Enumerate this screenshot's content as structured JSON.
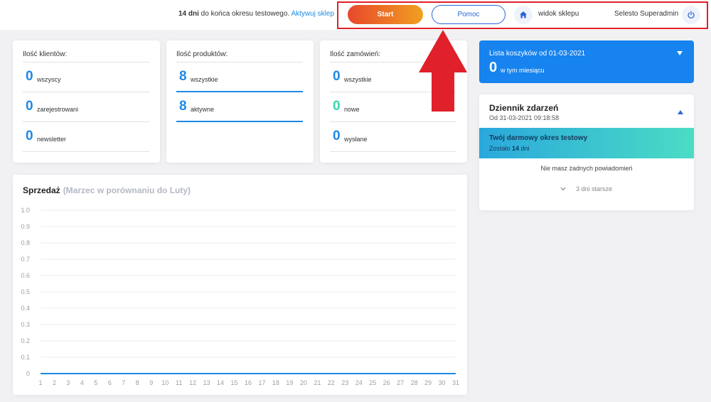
{
  "topbar": {
    "trial_days": "14 dni",
    "trial_text": " do końca okresu testowego. ",
    "activate_link": "Aktywuj sklep",
    "start_button": "Start",
    "help_button": "Pomoc",
    "shop_view_link": "widok sklepu",
    "user_name": "Selesto Superadmin",
    "home_icon": "home-icon",
    "power_icon": "power-icon"
  },
  "annotation": {
    "color": "#e0202a"
  },
  "stats": {
    "clients": {
      "title": "Ilość klientów:",
      "rows": [
        {
          "value": "0",
          "label": "wszyscy"
        },
        {
          "value": "0",
          "label": "zarejestrowani"
        },
        {
          "value": "0",
          "label": "newsletter"
        }
      ]
    },
    "products": {
      "title": "Ilość produktów:",
      "rows": [
        {
          "value": "8",
          "label": "wszystkie"
        },
        {
          "value": "8",
          "label": "aktywne"
        }
      ]
    },
    "orders": {
      "title": "Ilość zamówień:",
      "rows": [
        {
          "value": "0",
          "label": "wszystkie"
        },
        {
          "value": "0",
          "label": "nowe"
        },
        {
          "value": "0",
          "label": "wysłane"
        }
      ]
    }
  },
  "sales": {
    "title": "Sprzedaż",
    "subtitle": "(Marzec w porównaniu do Luty)"
  },
  "chart_data": {
    "type": "line",
    "title": "Sprzedaż",
    "subtitle": "(Marzec w porównaniu do Luty)",
    "x": [
      1,
      2,
      3,
      4,
      5,
      6,
      7,
      8,
      9,
      10,
      11,
      12,
      13,
      14,
      15,
      16,
      17,
      18,
      19,
      20,
      21,
      22,
      23,
      24,
      25,
      26,
      27,
      28,
      29,
      30,
      31
    ],
    "y_ticks": [
      "0",
      "0.1",
      "0.2",
      "0.3",
      "0.4",
      "0.5",
      "0.6",
      "0.7",
      "0.8",
      "0.9",
      "1.0"
    ],
    "ylim": [
      0,
      1
    ],
    "grid": true,
    "series": [
      {
        "values": [
          0,
          0,
          0,
          0,
          0,
          0,
          0,
          0,
          0,
          0,
          0,
          0,
          0,
          0,
          0,
          0,
          0,
          0,
          0,
          0,
          0,
          0,
          0,
          0,
          0,
          0,
          0,
          0,
          0,
          0,
          0
        ],
        "color": "#1e88e5"
      }
    ]
  },
  "carts": {
    "title": "Lista koszyków od 01-03-2021",
    "value": "0",
    "subtitle": "w tym miesiącu",
    "accent": "#1783ee"
  },
  "log": {
    "title": "Dziennik zdarzeń",
    "date": "Od 31-03-2021 09:18:58",
    "trial_title": "Twój darmowy okres testowy",
    "trial_left_prefix": "Zostało ",
    "trial_left_days": "14",
    "trial_left_suffix": " dni",
    "no_notifications": "Nie masz żadnych powiadomień",
    "older": "3 dni starsze"
  }
}
